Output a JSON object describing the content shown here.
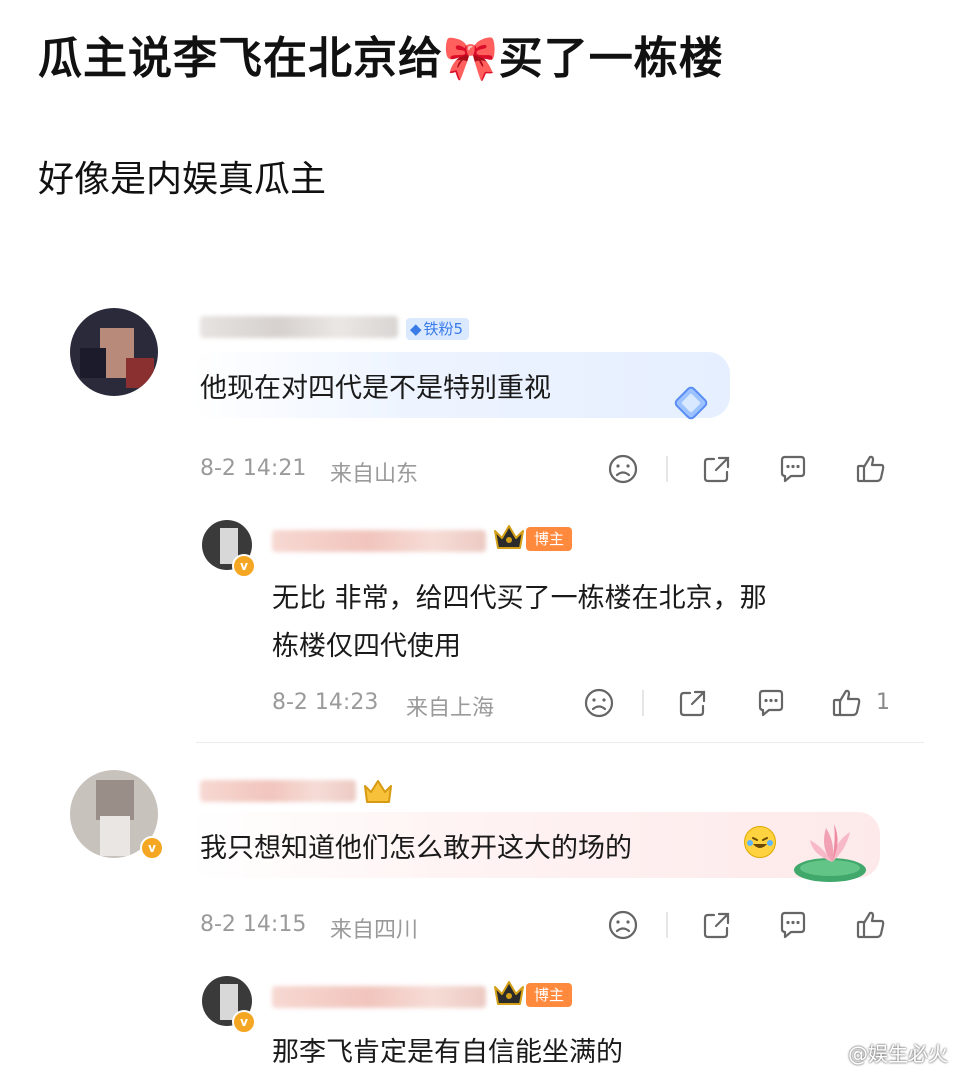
{
  "post": {
    "title": "瓜主说李飞在北京给🎀买了一栋楼",
    "subtitle": "好像是内娱真瓜主"
  },
  "comments": [
    {
      "badge": "铁粉5",
      "text": "他现在对四代是不是特别重视",
      "time": "8-2 14:21",
      "location": "来自山东",
      "likes": ""
    },
    {
      "badge": "博主",
      "text_line1": "无比 非常，给四代买了一栋楼在北京，那",
      "text_line2": "栋楼仅四代使用",
      "time": "8-2 14:23",
      "location": "来自上海",
      "likes": "1"
    },
    {
      "text": "我只想知道他们怎么敢开这大的场的",
      "time": "8-2 14:15",
      "location": "来自四川",
      "likes": ""
    },
    {
      "badge": "博主",
      "text": "那李飞肯定是有自信能坐满的"
    }
  ],
  "watermark": "@娱生必火",
  "colors": {
    "fan_badge": "#dbe9ff",
    "author_badge": "#ff8a3d",
    "meta_text": "#9a9a9a"
  },
  "icons": [
    "sad-face-icon",
    "share-icon",
    "comment-icon",
    "like-icon",
    "crown-icon",
    "verified-icon",
    "laugh-cry-emoji-icon"
  ]
}
